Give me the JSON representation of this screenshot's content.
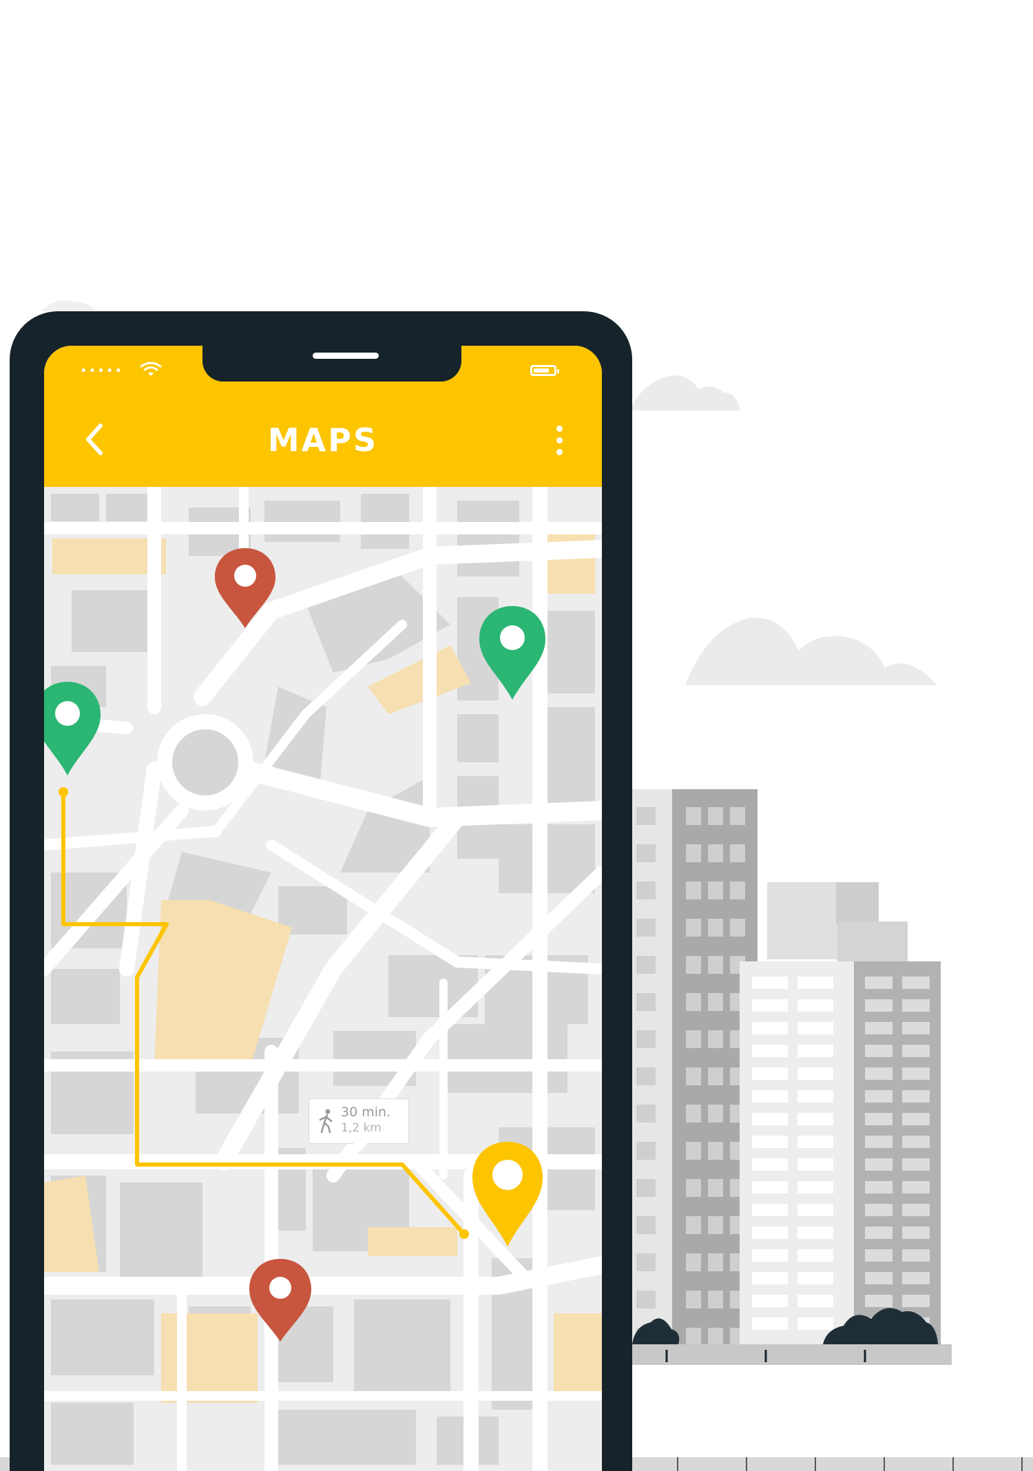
{
  "colors": {
    "accent": "#fdc400",
    "phone_frame": "#16232a",
    "pin_red": "#c8553d",
    "pin_green": "#2bb673",
    "pin_yellow": "#fdc400",
    "route": "#fdc400",
    "map_block": "#d6d6d6",
    "map_highlight": "#f6dfb0"
  },
  "status_bar": {
    "signal": "•••••",
    "wifi_icon": "wifi-icon",
    "battery_icon": "battery-icon"
  },
  "app_bar": {
    "title": "MAPS",
    "back_icon": "chevron-left-icon",
    "menu_icon": "more-vertical-icon"
  },
  "route_info": {
    "icon": "walking-icon",
    "time": "30 min.",
    "distance": "1,2 km"
  },
  "map_pins": [
    {
      "color": "red",
      "name": "location-pin-red-top"
    },
    {
      "color": "green",
      "name": "location-pin-green-right"
    },
    {
      "color": "green",
      "name": "location-pin-green-start"
    },
    {
      "color": "yellow",
      "name": "location-pin-yellow-destination"
    },
    {
      "color": "red",
      "name": "location-pin-red-bottom"
    }
  ]
}
